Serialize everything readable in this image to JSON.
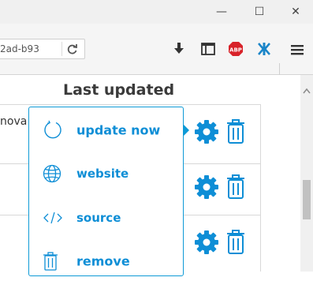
{
  "browser": {
    "url_text": "2ad-b93",
    "window_controls": {
      "minimize": "—",
      "maximize": "☐",
      "close": "✕"
    },
    "toolbar_icons": [
      "download-icon",
      "sidebar-icon",
      "adblock-plus-icon",
      "extension-icon",
      "menu-icon"
    ],
    "abp_label": "ABP"
  },
  "table": {
    "header": "Last updated",
    "rows": [
      {
        "text": "noval",
        "actions": [
          "gear-icon",
          "trash-icon"
        ]
      },
      {
        "text": "",
        "actions": [
          "gear-icon",
          "trash-icon"
        ]
      },
      {
        "text": "",
        "actions": [
          "gear-icon",
          "trash-icon"
        ]
      }
    ]
  },
  "popup_menu": {
    "items": [
      {
        "label": "update now",
        "icon": "refresh-icon"
      },
      {
        "label": "website",
        "icon": "globe-icon"
      },
      {
        "label": "source",
        "icon": "code-icon"
      },
      {
        "label": "remove",
        "icon": "trash-icon"
      }
    ]
  },
  "colors": {
    "accent": "#0e8ed6",
    "border_accent": "#0e9ad6",
    "abp_red": "#d8232a",
    "extension_blue": "#1a85c8"
  }
}
